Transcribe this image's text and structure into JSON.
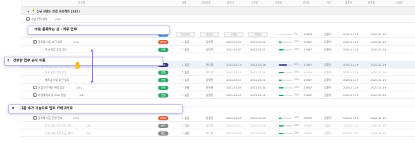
{
  "columns": [
    "업무명",
    "상태",
    "우선순위",
    "담당자",
    "시작일",
    "마감일",
    "진척도",
    "기간",
    "등록자",
    "등록일",
    "수정일"
  ],
  "group": {
    "title": "신규 브랜드 런칭 프로젝트",
    "count": "(345)"
  },
  "rows": [
    {
      "title": "사업 전략 회의",
      "count": "(24)",
      "status": "",
      "priority": "",
      "assignee": "",
      "start": "",
      "end": "",
      "progress": null,
      "progress_label": "",
      "duration": "",
      "author": "",
      "reg": "",
      "mod": ""
    },
    {
      "title": "",
      "count": "",
      "status": "진행",
      "status_color": "#3d8bd9",
      "priority": "우선순위",
      "assignee": "담당자",
      "start": "시작일",
      "end": "마감일",
      "progress": 0.0,
      "progress_label": "0%",
      "duration": "45678",
      "author": "김용석",
      "reg": "2020-11-19",
      "mod": "2020-11-19",
      "placeholder": true
    },
    {
      "title": "글로벌 사업 추진 업무",
      "count": "(24)",
      "status": "미처리",
      "status_color": "#e0603a",
      "priority": "높음",
      "assignee": "김영민",
      "start": "2022-03-07",
      "end": "2022-03-21",
      "progress": 0.2,
      "progress_label": "20%",
      "duration": "23567",
      "author": "김용석",
      "reg": "2020-11-19",
      "mod": "2020-11-19"
    },
    {
      "title": "미국 사업 추진 업무",
      "count": "",
      "status": "진행",
      "status_color": "#2faa6b",
      "priority": "높음",
      "assignee": "김민아",
      "start": "2022-03-07",
      "end": "2022-03-21",
      "progress": 0.35,
      "progress_label": "35%",
      "duration": "23567",
      "author": "김용석",
      "reg": "2020-11-19",
      "mod": "2020-11-19"
    },
    {
      "title": "",
      "count": "",
      "status": "보류",
      "status_color": "#3c3a8f",
      "priority": "낮음",
      "assignee": "여나영",
      "start": "2022-03-14",
      "end": "2022-03-18",
      "progress": 0.6,
      "progress_label": "60%",
      "duration": "23567",
      "author": "김용석",
      "reg": "2020-11-19",
      "mod": "2020-11-19"
    },
    {
      "title": "일본 사업 추진 업무",
      "count": "",
      "status": "진행",
      "status_color": "#2faa6b",
      "priority": "높음",
      "assignee": "여나영",
      "start": "2022-03-14",
      "end": "2022-03-31",
      "progress": 0.35,
      "progress_label": "35%",
      "duration": "81425",
      "author": "김용석",
      "reg": "2020-11-19",
      "mod": "2020-11-19",
      "fade": true
    },
    {
      "title": "베트남 사업 추진 업무",
      "count": "",
      "status": "진행",
      "status_color": "#2faa6b",
      "priority": "높음",
      "assignee": "김영민",
      "start": "2022-03-07",
      "end": "2022-03-21",
      "progress": 0.2,
      "progress_label": "20%",
      "duration": "23567",
      "author": "김용석",
      "reg": "2020-11-19",
      "mod": "2020-11-19"
    },
    {
      "title": "사업추진 예산 편성 업무",
      "count": "(24)",
      "status": "진행",
      "status_color": "#2faa6b",
      "priority": "보통",
      "assignee": "전옥현",
      "start": "2022-03-05",
      "end": "2022-03-31",
      "progress": 0.35,
      "progress_label": "35%",
      "duration": "23567",
      "author": "김용석",
      "reg": "2020-11-19",
      "mod": "2020-11-19"
    },
    {
      "title": "사업계획서 및 R&D 편성",
      "count": "(24)",
      "status": "진행",
      "status_color": "#2faa6b",
      "priority": "높음",
      "assignee": "김영민",
      "start": "2022-04-01",
      "end": "2022-04-11",
      "progress": 0.35,
      "progress_label": "35%",
      "duration": "23567",
      "author": "김용석",
      "reg": "2020-11-19",
      "mod": "2020-11-19"
    },
    {
      "title": "",
      "count": "",
      "status": "",
      "status_color": "#2faa6b",
      "priority": "",
      "assignee": "",
      "start": "",
      "end": "",
      "progress": null,
      "progress_label": "",
      "duration": "",
      "author": "",
      "reg": "",
      "mod": ""
    },
    {
      "title": "글로벌 자금 운영 관리",
      "count": "(24)",
      "status": "미처리",
      "status_color": "#e0603a",
      "priority": "높음",
      "assignee": "김영민",
      "start": "2022-03-02",
      "end": "2022-03-20",
      "progress": 0.2,
      "progress_label": "20%",
      "duration": "23567",
      "author": "김용석",
      "reg": "2020-11-19",
      "mod": "2020-11-19"
    },
    {
      "title": "미국 사업 추진 자금 관리",
      "count": "(24)",
      "status": "중단",
      "status_color": "#8a8a8a",
      "priority": "긴급",
      "assignee": "김민아",
      "start": "2022-03-07",
      "end": "2022-03-30",
      "progress": 0.35,
      "progress_label": "35%",
      "duration": "23567",
      "author": "김용석",
      "reg": "2020-11-19",
      "mod": "2020-11-19",
      "fade": true
    },
    {
      "title": "유럽 사업 추진 자금 관리",
      "count": "(24)",
      "status": "중단",
      "status_color": "#8a8a8a",
      "priority": "낮음",
      "assignee": "여나영",
      "start": "2022-03-14",
      "end": "2022-03-31",
      "progress": 0.35,
      "progress_label": "35%",
      "duration": "23567",
      "author": "김용석",
      "reg": "2020-11-19",
      "mod": "2020-11-19",
      "fade": true
    }
  ],
  "overlays": {
    "callout1": "바로 등록하는 상 · 하위 업무",
    "callout2": "간편한 업무 순서 이동",
    "callout3": "그룹 추가 기능으로 업무 카테고리화"
  },
  "colors": {
    "accent": "#6b6fd6",
    "progress_green": "#2faa6b",
    "progress_navy": "#3c3a8f",
    "priority_up": "#e0603a",
    "priority_down": "#3d8bd9"
  }
}
